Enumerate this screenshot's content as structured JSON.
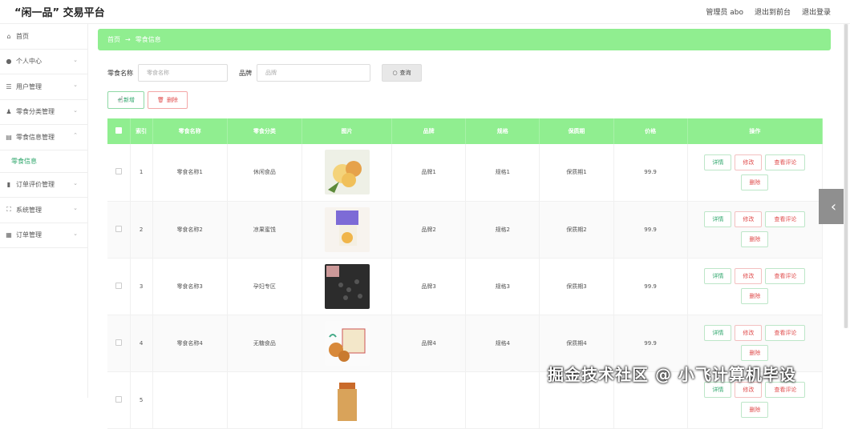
{
  "header": {
    "brand": "“闲一品” 交易平台",
    "admin_label": "管理员 abo",
    "back_front": "退出到前台",
    "logout": "退出登录"
  },
  "sidebar": {
    "items": [
      {
        "label": "首页",
        "icon": "home-icon",
        "glyph": "⌂",
        "chev": ""
      },
      {
        "label": "个人中心",
        "icon": "user-icon",
        "glyph": "👤",
        "chev": "⌄"
      },
      {
        "label": "用户管理",
        "icon": "list-icon",
        "glyph": "☰",
        "chev": "⌄"
      },
      {
        "label": "零食分类管理",
        "icon": "category-icon",
        "glyph": "⚲",
        "chev": "⌄"
      },
      {
        "label": "零食信息管理",
        "icon": "info-icon",
        "glyph": "▤",
        "chev": "⌃"
      },
      {
        "label": "零食信息",
        "sub": true
      },
      {
        "label": "订单评价管理",
        "icon": "chart-icon",
        "glyph": "▮",
        "chev": "⌄"
      },
      {
        "label": "系统管理",
        "icon": "system-icon",
        "glyph": "⛶",
        "chev": "⌄"
      },
      {
        "label": "订单管理",
        "icon": "order-icon",
        "glyph": "▦",
        "chev": "⌄"
      }
    ]
  },
  "breadcrumb": {
    "home": "首页",
    "sep": "→",
    "current": "零食信息"
  },
  "search": {
    "name_label": "零食名称",
    "name_placeholder": "零食名称",
    "brand_label": "品牌",
    "brand_placeholder": "品牌",
    "query_button": "查询"
  },
  "actions": {
    "add": "新增",
    "delete": "删除"
  },
  "table": {
    "headers": [
      "",
      "索引",
      "零食名称",
      "零食分类",
      "图片",
      "品牌",
      "规格",
      "保质期",
      "价格",
      "操作"
    ],
    "rows": [
      {
        "index": "1",
        "name": "零食名称1",
        "category": "休闲食品",
        "brand": "品牌1",
        "spec": "规格1",
        "shelf": "保质期1",
        "price": "99.9",
        "img": "cookie"
      },
      {
        "index": "2",
        "name": "零食名称2",
        "category": "凉果蜜饯",
        "brand": "品牌2",
        "spec": "规格2",
        "shelf": "保质期2",
        "price": "99.9",
        "img": "candy"
      },
      {
        "index": "3",
        "name": "零食名称3",
        "category": "孕妇专区",
        "brand": "品牌3",
        "spec": "规格3",
        "shelf": "保质期3",
        "price": "99.9",
        "img": "seeds"
      },
      {
        "index": "4",
        "name": "零食名称4",
        "category": "无糖食品",
        "brand": "品牌4",
        "spec": "规格4",
        "shelf": "保质期4",
        "price": "99.9",
        "img": "biscuit"
      },
      {
        "index": "5",
        "name": "",
        "category": "",
        "brand": "",
        "spec": "",
        "shelf": "",
        "price": "",
        "img": "jar"
      }
    ],
    "ops": {
      "detail": "详情",
      "edit": "修改",
      "review": "查看评论",
      "remove": "删除"
    }
  },
  "watermark": "掘金技术社区 @ 小飞计算机毕设"
}
